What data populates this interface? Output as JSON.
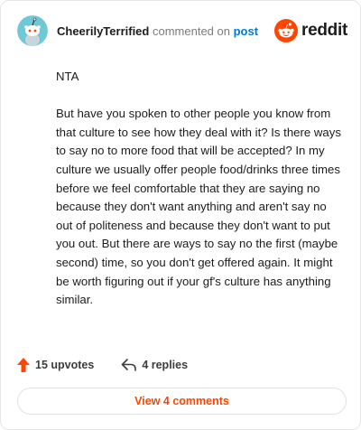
{
  "header": {
    "username": "CheerilyTerrified",
    "action": "commented on",
    "post_link": "post",
    "brand": "reddit"
  },
  "comment": {
    "paragraphs": [
      "NTA",
      "But have you spoken to other people you know from that culture to see how they deal with it? Is there ways to say no to more food that will be accepted? In my culture we usually offer people food/drinks three times before we feel comfortable that they are saying no because they don't want anything and aren't say no out of politeness and because they don't want to put you out. But there are ways to say no the first (maybe second) time, so you don't get offered again. It might be worth figuring out if your gf's culture has anything similar."
    ]
  },
  "footer": {
    "upvotes": "15 upvotes",
    "replies": "4 replies",
    "view_comments": "View 4 comments"
  },
  "colors": {
    "brand": "#ff4500",
    "link": "#0079d3",
    "avatar_bg": "#6ec8d6"
  },
  "icons": {
    "avatar": "snoo-avatar-icon",
    "logo": "reddit-logo-icon",
    "upvote": "upvote-arrow-icon",
    "reply": "reply-arrow-icon"
  }
}
